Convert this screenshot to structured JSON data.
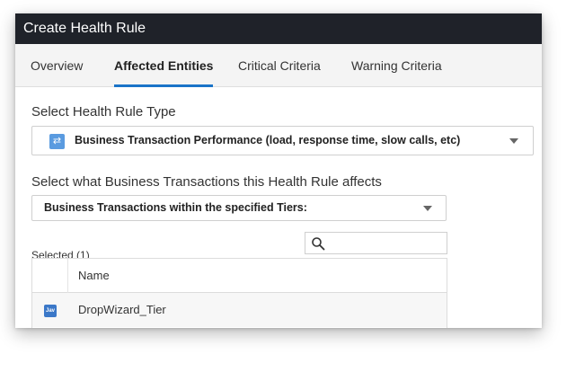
{
  "window": {
    "title": "Create Health Rule"
  },
  "tabs": [
    {
      "label": "Overview",
      "active": false
    },
    {
      "label": "Affected Entities",
      "active": true
    },
    {
      "label": "Critical Criteria",
      "active": false
    },
    {
      "label": "Warning Criteria",
      "active": false
    }
  ],
  "rule_type": {
    "label": "Select Health Rule Type",
    "selected": "Business Transaction Performance (load, response time, slow calls, etc)",
    "icon": "transfer-arrows-icon"
  },
  "affects": {
    "label": "Select what Business Transactions this Health Rule affects",
    "selected": "Business Transactions within the specified Tiers:"
  },
  "selection": {
    "count_label": "Selected (1)",
    "search_placeholder": ""
  },
  "table": {
    "columns": [
      "Name"
    ],
    "rows": [
      {
        "badge": "Jav",
        "name": "DropWizard_Tier"
      }
    ]
  },
  "colors": {
    "titlebar": "#1f2229",
    "accent": "#1a73c8",
    "java_badge": "#3b78c8",
    "bt_icon": "#5a9be0"
  }
}
